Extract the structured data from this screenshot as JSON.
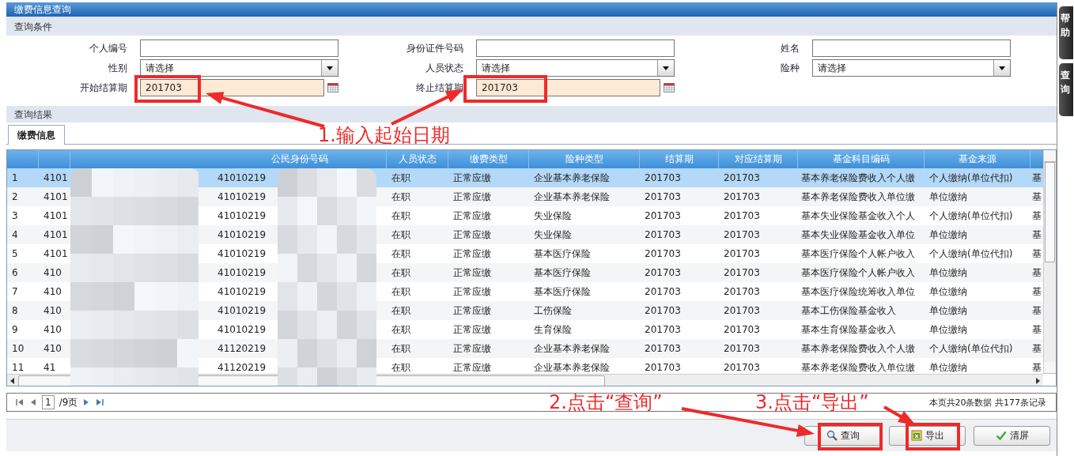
{
  "window": {
    "title": "缴费信息查询"
  },
  "side_tabs": [
    {
      "label": "帮助"
    },
    {
      "label": "查询"
    }
  ],
  "query_section": {
    "title": "查询条件",
    "fields": [
      {
        "kind": "text",
        "label": "个人编号"
      },
      {
        "kind": "text",
        "label": "身份证件号码"
      },
      {
        "kind": "text",
        "label": "姓名"
      },
      {
        "kind": "select",
        "label": "性别",
        "value": "请选择"
      },
      {
        "kind": "select",
        "label": "人员状态",
        "value": "请选择"
      },
      {
        "kind": "select",
        "label": "险种",
        "value": "请选择"
      },
      {
        "kind": "date",
        "label": "开始结算期",
        "value": "201703"
      },
      {
        "kind": "date",
        "label": "终止结算期",
        "value": "201703"
      }
    ]
  },
  "results_section": {
    "title": "查询结果",
    "tabs": [
      {
        "label": "缴费信息",
        "selected": true
      }
    ]
  },
  "table": {
    "columns": [
      "",
      "",
      "公民身份号码",
      "人员状态",
      "缴费类型",
      "险种类型",
      "结算期",
      "对应结算期",
      "基金科目编码",
      "基金来源",
      ""
    ],
    "rows": [
      {
        "selected": true,
        "cells": [
          "1",
          "4101",
          "41010219",
          "在职",
          "正常应缴",
          "企业基本养老保险",
          "201703",
          "201703",
          "基本养老保险费收入个人缴",
          "个人缴纳(单位代扣)",
          "基"
        ]
      },
      {
        "selected": false,
        "cells": [
          "2",
          "4101",
          "41010219",
          "在职",
          "正常应缴",
          "企业基本养老保险",
          "201703",
          "201703",
          "基本养老保险费收入单位缴",
          "单位缴纳",
          "基"
        ]
      },
      {
        "selected": false,
        "cells": [
          "3",
          "4101",
          "41010219",
          "在职",
          "正常应缴",
          "失业保险",
          "201703",
          "201703",
          "基本失业保险基金收入个人",
          "个人缴纳(单位代扣)",
          "基"
        ]
      },
      {
        "selected": false,
        "cells": [
          "4",
          "4101",
          "41010219",
          "在职",
          "正常应缴",
          "失业保险",
          "201703",
          "201703",
          "基本失业保险基金收入单位",
          "单位缴纳",
          "基"
        ]
      },
      {
        "selected": false,
        "cells": [
          "5",
          "4101",
          "41010219",
          "在职",
          "正常应缴",
          "基本医疗保险",
          "201703",
          "201703",
          "基本医疗保险个人帐户收入",
          "个人缴纳(单位代扣)",
          "基"
        ]
      },
      {
        "selected": false,
        "cells": [
          "6",
          "410",
          "41010219",
          "在职",
          "正常应缴",
          "基本医疗保险",
          "201703",
          "201703",
          "基本医疗保险个人帐户收入",
          "单位缴纳",
          "基"
        ]
      },
      {
        "selected": false,
        "cells": [
          "7",
          "410",
          "41010219",
          "在职",
          "正常应缴",
          "基本医疗保险",
          "201703",
          "201703",
          "基本医疗保险统筹收入单位",
          "单位缴纳",
          "基"
        ]
      },
      {
        "selected": false,
        "cells": [
          "8",
          "410",
          "41010219",
          "在职",
          "正常应缴",
          "工伤保险",
          "201703",
          "201703",
          "基本工伤保险基金收入",
          "单位缴纳",
          "基"
        ]
      },
      {
        "selected": false,
        "cells": [
          "9",
          "410",
          "41010219",
          "在职",
          "正常应缴",
          "生育保险",
          "201703",
          "201703",
          "基本生育保险基金收入",
          "单位缴纳",
          "基"
        ]
      },
      {
        "selected": false,
        "cells": [
          "10",
          "410",
          "41120219",
          "在职",
          "正常应缴",
          "企业基本养老保险",
          "201703",
          "201703",
          "基本养老保险费收入个人缴",
          "个人缴纳(单位代扣)",
          "基"
        ]
      },
      {
        "selected": false,
        "cells": [
          "11",
          "41",
          "41120219",
          "在职",
          "正常应缴",
          "企业基本养老保险",
          "201703",
          "201703",
          "基本养老保险费收入单位缴",
          "单位缴纳",
          "基"
        ]
      }
    ]
  },
  "pager": {
    "page": "1",
    "total_pages": "/9页",
    "summary": "本页共20条数据 共177条记录"
  },
  "buttons": [
    {
      "kind": "search",
      "label": "查询"
    },
    {
      "kind": "export",
      "label": "导出"
    },
    {
      "kind": "clear",
      "label": "清屏"
    }
  ],
  "annotations": [
    {
      "text": "1.输入起始日期"
    },
    {
      "text": "2.点击“查询”"
    },
    {
      "text": "3.点击“导出”"
    }
  ]
}
